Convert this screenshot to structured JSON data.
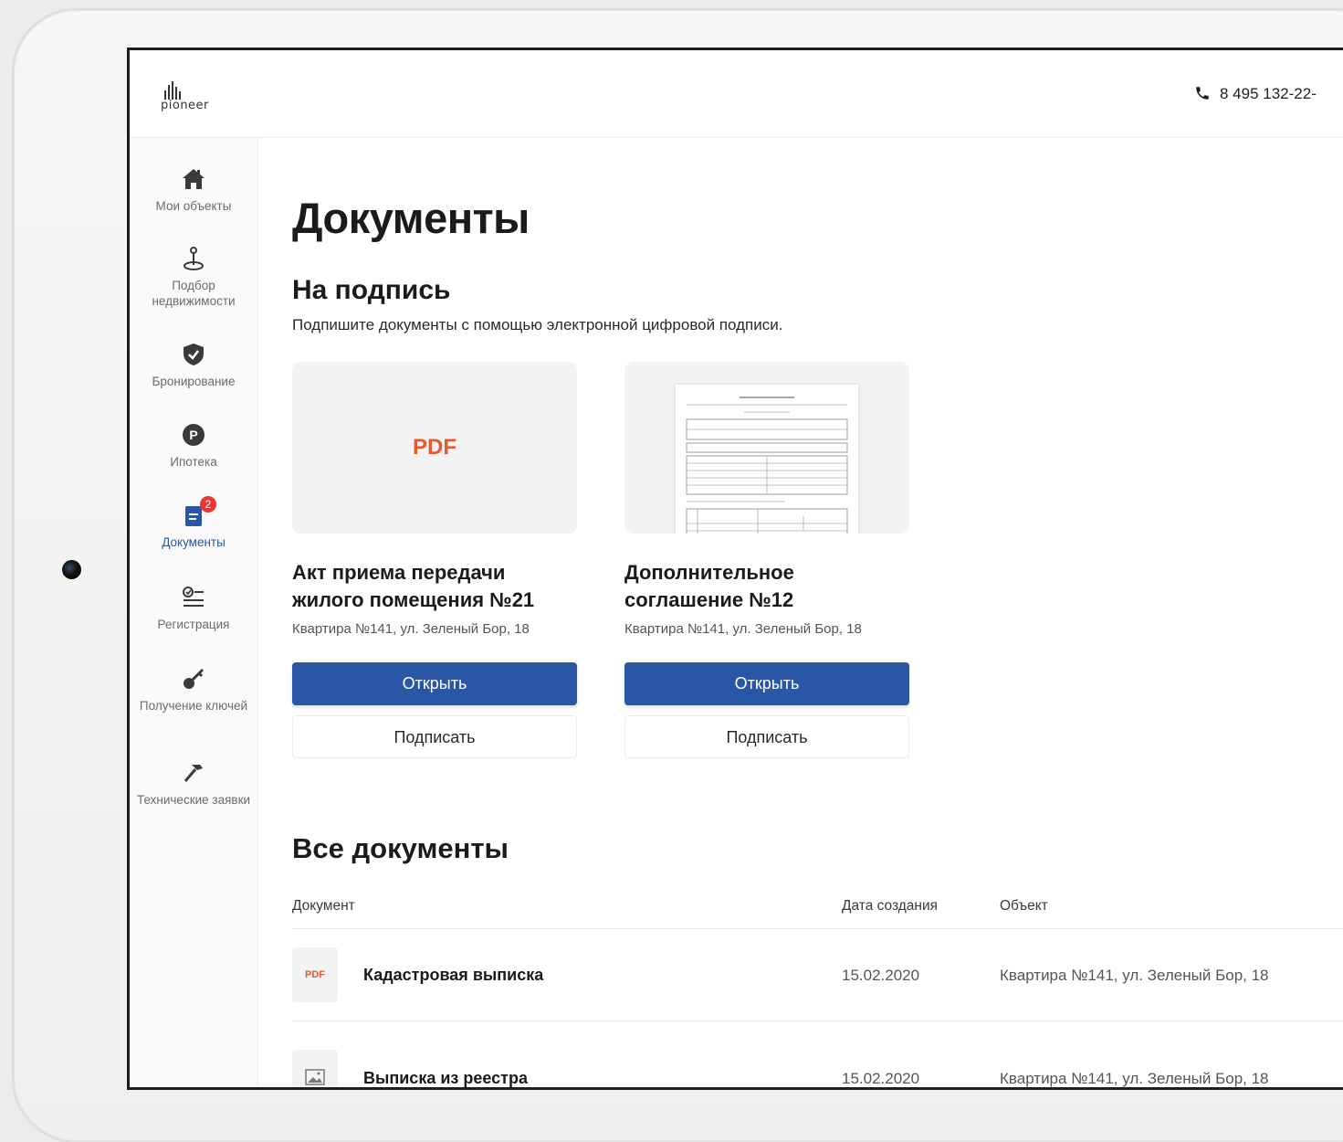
{
  "header": {
    "logo_text": "pioneer",
    "phone": "8 495 132-22-"
  },
  "sidebar": {
    "items": [
      {
        "label": "Мои объекты",
        "icon": "home-icon"
      },
      {
        "label": "Подбор недвижимости",
        "icon": "location-pin-icon"
      },
      {
        "label": "Бронирование",
        "icon": "shield-check-icon"
      },
      {
        "label": "Ипотека",
        "icon": "mortgage-p-icon"
      },
      {
        "label": "Документы",
        "icon": "documents-icon",
        "badge": "2",
        "active": true
      },
      {
        "label": "Регистрация",
        "icon": "registration-checklist-icon"
      },
      {
        "label": "Получение ключей",
        "icon": "key-icon"
      },
      {
        "label": "Технические заявки",
        "icon": "hammer-icon"
      }
    ]
  },
  "main": {
    "title": "Документы",
    "to_sign": {
      "title": "На подпись",
      "subtitle": "Подпишите документы с помощью электронной цифровой подписи.",
      "cards": [
        {
          "thumb_label": "PDF",
          "name": "Акт приема передачи жилого помещения №21",
          "address": "Квартира №141, ул. Зеленый Бор, 18",
          "open_label": "Открыть",
          "sign_label": "Подписать"
        },
        {
          "thumb_label": "",
          "name": "Дополнительное соглашение №12",
          "address": "Квартира №141, ул. Зеленый Бор, 18",
          "open_label": "Открыть",
          "sign_label": "Подписать"
        }
      ]
    },
    "all_docs": {
      "title": "Все документы",
      "columns": [
        "Документ",
        "Дата создания",
        "Объект"
      ],
      "rows": [
        {
          "type_label": "PDF",
          "name": "Кадастровая выписка",
          "date": "15.02.2020",
          "object": "Квартира №141, ул. Зеленый Бор, 18"
        },
        {
          "type_label": "",
          "name": "Выписка из реестра",
          "date": "15.02.2020",
          "object": "Квартира №141, ул. Зеленый Бор, 18"
        }
      ]
    }
  },
  "colors": {
    "accent": "#2a56a6",
    "pdf": "#e65a2f",
    "badge": "#e53935"
  }
}
